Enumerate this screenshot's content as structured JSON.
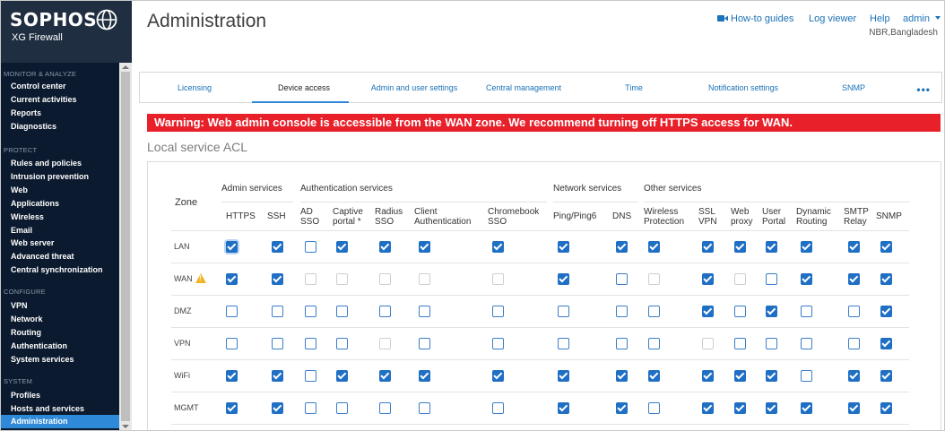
{
  "brand": {
    "name": "SOPHOS",
    "product": "XG Firewall",
    "logo_icon": "globe-icon"
  },
  "sidebar": {
    "sections": [
      {
        "title": "MONITOR & ANALYZE",
        "items": [
          "Control center",
          "Current activities",
          "Reports",
          "Diagnostics"
        ]
      },
      {
        "title": "PROTECT",
        "items": [
          "Rules and policies",
          "Intrusion prevention",
          "Web",
          "Applications",
          "Wireless",
          "Email",
          "Web server",
          "Advanced threat",
          "Central synchronization"
        ]
      },
      {
        "title": "CONFIGURE",
        "items": [
          "VPN",
          "Network",
          "Routing",
          "Authentication",
          "System services"
        ]
      },
      {
        "title": "SYSTEM",
        "items": [
          "Profiles",
          "Hosts and services",
          "Administration"
        ]
      }
    ],
    "active_item": "Administration"
  },
  "header": {
    "title": "Administration",
    "links": {
      "howto": "How-to guides",
      "howto_icon": "video-camera-icon",
      "log": "Log viewer",
      "help": "Help",
      "user": "admin"
    },
    "location": "NBR,Bangladesh"
  },
  "tabs": {
    "items": [
      "Licensing",
      "Device access",
      "Admin and user settings",
      "Central management",
      "Time",
      "Notification settings",
      "SNMP"
    ],
    "active": "Device access",
    "more": "•••"
  },
  "warning": "Warning: Web admin console is accessible from the WAN zone. We recommend turning off HTTPS access for WAN.",
  "acl": {
    "title": "Local service ACL",
    "zone_header": "Zone",
    "groups": [
      "Admin services",
      "Authentication services",
      "Network services",
      "Other services"
    ],
    "columns": [
      [
        "HTTPS"
      ],
      [
        "SSH"
      ],
      [
        "AD",
        "SSO"
      ],
      [
        "Captive",
        "portal *"
      ],
      [
        "Radius",
        "SSO"
      ],
      [
        "Client",
        "Authentication"
      ],
      [
        "Chromebook",
        "SSO"
      ],
      [
        "Ping/Ping6"
      ],
      [
        "DNS"
      ],
      [
        "Wireless",
        "Protection"
      ],
      [
        "SSL",
        "VPN"
      ],
      [
        "Web",
        "proxy"
      ],
      [
        "User",
        "Portal"
      ],
      [
        "Dynamic",
        "Routing"
      ],
      [
        "SMTP",
        "Relay"
      ],
      [
        "SNMP"
      ]
    ],
    "rows": [
      {
        "zone": "LAN",
        "warn": false,
        "states": [
          "on",
          "on",
          "off",
          "on",
          "on",
          "on",
          "on",
          "on",
          "on",
          "on",
          "on",
          "on",
          "on",
          "on",
          "on",
          "on"
        ]
      },
      {
        "zone": "WAN",
        "warn": true,
        "states": [
          "on",
          "on",
          "dis",
          "dis",
          "dis",
          "dis",
          "dis",
          "on",
          "off",
          "dis",
          "on",
          "dis",
          "off",
          "on",
          "on",
          "on"
        ]
      },
      {
        "zone": "DMZ",
        "warn": false,
        "states": [
          "off",
          "off",
          "off",
          "off",
          "off",
          "off",
          "off",
          "off",
          "off",
          "off",
          "on",
          "off",
          "on",
          "off",
          "off",
          "on"
        ]
      },
      {
        "zone": "VPN",
        "warn": false,
        "states": [
          "off",
          "off",
          "off",
          "off",
          "dis",
          "off",
          "off",
          "off",
          "off",
          "off",
          "dis",
          "off",
          "off",
          "off",
          "off",
          "on"
        ]
      },
      {
        "zone": "WiFi",
        "warn": false,
        "states": [
          "on",
          "on",
          "off",
          "on",
          "on",
          "on",
          "on",
          "on",
          "on",
          "on",
          "on",
          "on",
          "on",
          "off",
          "on",
          "on"
        ]
      },
      {
        "zone": "MGMT",
        "warn": false,
        "states": [
          "on",
          "on",
          "off",
          "off",
          "off",
          "off",
          "off",
          "on",
          "on",
          "off",
          "on",
          "on",
          "on",
          "on",
          "on",
          "on"
        ]
      }
    ]
  }
}
